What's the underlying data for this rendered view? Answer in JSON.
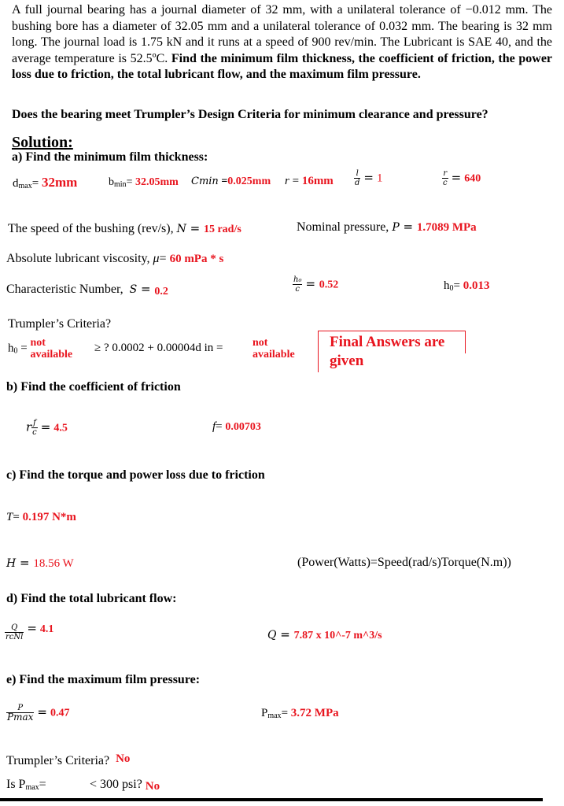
{
  "problem": {
    "text_plain": "A full journal bearing has a journal diameter of 32 mm, with a unilateral tolerance of −0.012 mm. The bushing bore has a diameter of 32.05 mm and a unilateral tolerance of 0.032 mm. The bearing is 32 mm long. The journal load is 1.75 kN and it runs at a speed of 900 rev/min. The Lubricant is SAE 40, and the average temperature is 52.5ºC.",
    "text_bold": "Find the minimum film thickness, the coefficient of friction, the power loss due to friction, the total lubricant flow, and the maximum film pressure.",
    "question": "Does the bearing meet Trumpler’s Design Criteria for minimum clearance and pressure?"
  },
  "solution_heading": "Solution:",
  "part_a": {
    "heading": "a)  Find the minimum film thickness:",
    "dmax_label": "d",
    "dmax_sub": "max",
    "dmax_eq": "= ",
    "dmax_value": "32mm",
    "bmin_label": "b",
    "bmin_sub": "min",
    "bmin_eq": "= ",
    "bmin_value": "32.05mm",
    "cmin_label": "Cmin",
    "cmin_eq": " =",
    "cmin_value": "0.025mm",
    "r_label": "r",
    "r_eq": " = ",
    "r_value": "16mm",
    "ld_num": "l",
    "ld_den": "d",
    "ld_eq": "=",
    "ld_value": "1",
    "rc_num": "r",
    "rc_den": "c",
    "rc_eq": "=",
    "rc_value": "640",
    "speed_label": "The speed of the bushing (rev/s),",
    "speed_var": "N",
    "speed_eq": " = ",
    "speed_value": "15 rad/s",
    "pressure_label": "Nominal pressure,",
    "pressure_var": "P",
    "pressure_eq": " = ",
    "pressure_value": "1.7089 MPa",
    "visc_label": "Absolute lubricant viscosity,",
    "visc_var": "μ",
    "visc_eq": "= ",
    "visc_value": "60 mPa * s",
    "char_label": "Characteristic Number,",
    "char_var": "S",
    "char_eq": " = ",
    "char_value": "0.2",
    "hoc_num": "h₀",
    "hoc_den": "c",
    "hoc_eq": "= ",
    "hoc_value": "0.52",
    "ho_label": "h",
    "ho_sub": "0",
    "ho_eq": "= ",
    "ho_value": "0.013",
    "trumpler_label": "Trumpler’s Criteria?",
    "ho2_label": "h",
    "ho2_sub": "0",
    "ho2_eq": " = ",
    "ho2_value_l1": "not",
    "ho2_value_l2": "available",
    "criterion_text": "≥ ? 0.0002 + 0.00004d in = ",
    "criterion_value_l1": "not",
    "criterion_value_l2": "available",
    "note_l1": "Final Answers are",
    "note_l2": "given"
  },
  "part_b": {
    "heading": "b)  Find the coefficient of friction",
    "rfc_pre": "r",
    "rfc_num": "f",
    "rfc_den": "c",
    "rfc_eq": "=",
    "rfc_value": "4.5",
    "f_label": "f",
    "f_eq": "= ",
    "f_value": "0.00703"
  },
  "part_c": {
    "heading": "c)  Find the torque and power loss due to friction",
    "t_label": "T",
    "t_eq": "= ",
    "t_value": "0.197 N*m",
    "h_label": "H",
    "h_eq": " = ",
    "h_value": "18.56 W",
    "power_note": "(Power(Watts)=Speed(rad/s)Torque(N.m))"
  },
  "part_d": {
    "heading": "d)  Find the total lubricant flow:",
    "flow_num": "Q",
    "flow_den": "rcNl",
    "flow_eq": "=",
    "flow_value": "4.1",
    "q_label": "Q",
    "q_eq": " = ",
    "q_value": "7.87 x 10^-7  m^3/s"
  },
  "part_e": {
    "heading": "e)  Find the maximum film pressure:",
    "ratio_num": "P",
    "ratio_den": "Pmax",
    "ratio_eq": "=",
    "ratio_value": "0.47",
    "pmax_label": "P",
    "pmax_sub": "max",
    "pmax_eq": "= ",
    "pmax_value": "3.72 MPa",
    "trumpler_label": "Trumpler’s Criteria?",
    "trumpler_value": "No",
    "is_pmax_label": "Is P",
    "is_pmax_sub": "max",
    "is_pmax_eq": "=",
    "is_pmax_text": "< 300 psi?",
    "is_pmax_value": "No"
  },
  "colors": {
    "answer": "#e8141e",
    "text": "#000000"
  }
}
